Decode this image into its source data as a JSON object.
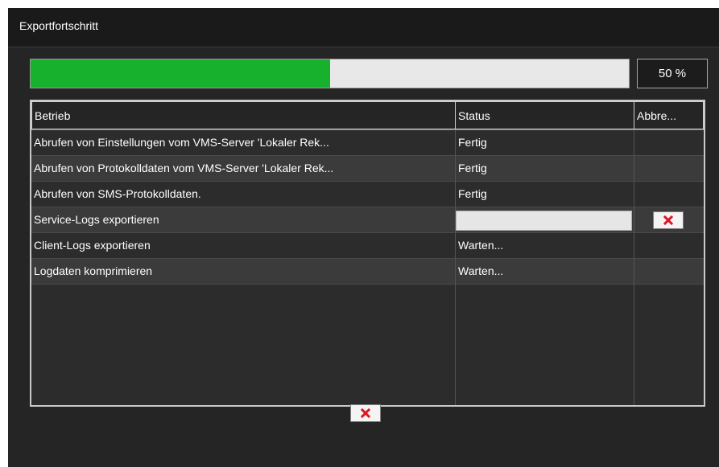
{
  "dialog": {
    "title": "Exportfortschritt"
  },
  "progress": {
    "value": 0.5,
    "label": "50 %"
  },
  "table": {
    "columns": [
      "Betrieb",
      "Status",
      "Abbre..."
    ],
    "rows": [
      {
        "operation": "Abrufen von Einstellungen vom VMS-Server 'Lokaler Rek...",
        "status": "Fertig"
      },
      {
        "operation": "Abrufen von Protokolldaten vom VMS-Server 'Lokaler Rek...",
        "status": "Fertig"
      },
      {
        "operation": "Abrufen von SMS-Protokolldaten.",
        "status": "Fertig"
      },
      {
        "operation": "Service-Logs exportieren",
        "status": ""
      },
      {
        "operation": "Client-Logs exportieren",
        "status": "Warten..."
      },
      {
        "operation": "Logdaten komprimieren",
        "status": "Warten..."
      }
    ]
  },
  "icons": {
    "row_cancel": "close-x-icon",
    "main_cancel": "close-x-icon"
  },
  "colors": {
    "progress_fill": "#17b12e",
    "cancel_x": "#e0141e"
  }
}
